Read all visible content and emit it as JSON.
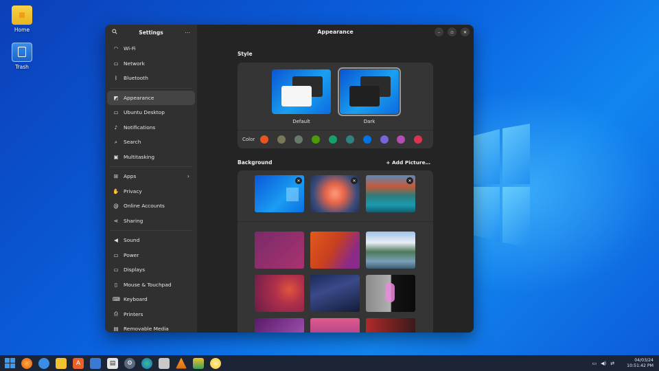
{
  "desktop": {
    "icons": [
      {
        "label": "Home",
        "icon": "folder-icon"
      },
      {
        "label": "Trash",
        "icon": "trash-icon"
      }
    ]
  },
  "sidebar": {
    "title": "Settings",
    "items": [
      {
        "label": "Wi-Fi",
        "icon": "wifi-icon"
      },
      {
        "label": "Network",
        "icon": "network-icon"
      },
      {
        "label": "Bluetooth",
        "icon": "bluetooth-icon"
      },
      {
        "label": "Appearance",
        "icon": "appearance-icon",
        "active": true
      },
      {
        "label": "Ubuntu Desktop",
        "icon": "ubuntu-desktop-icon"
      },
      {
        "label": "Notifications",
        "icon": "bell-icon"
      },
      {
        "label": "Search",
        "icon": "search-icon"
      },
      {
        "label": "Multitasking",
        "icon": "multitasking-icon"
      },
      {
        "label": "Apps",
        "icon": "apps-icon"
      },
      {
        "label": "Privacy",
        "icon": "privacy-icon"
      },
      {
        "label": "Online Accounts",
        "icon": "online-accounts-icon"
      },
      {
        "label": "Sharing",
        "icon": "sharing-icon"
      },
      {
        "label": "Sound",
        "icon": "sound-icon"
      },
      {
        "label": "Power",
        "icon": "power-icon"
      },
      {
        "label": "Displays",
        "icon": "displays-icon"
      },
      {
        "label": "Mouse & Touchpad",
        "icon": "mouse-icon"
      },
      {
        "label": "Keyboard",
        "icon": "keyboard-icon"
      },
      {
        "label": "Printers",
        "icon": "printer-icon"
      },
      {
        "label": "Removable Media",
        "icon": "removable-media-icon"
      }
    ]
  },
  "main": {
    "title": "Appearance",
    "style_label": "Style",
    "styles": [
      {
        "label": "Default",
        "selected": false
      },
      {
        "label": "Dark",
        "selected": true
      }
    ],
    "color_label": "Color",
    "accent_colors": [
      "#e95420",
      "#787859",
      "#657b69",
      "#4e9a06",
      "#18a06a",
      "#308280",
      "#0073e5",
      "#7764d8",
      "#b34cb3",
      "#da3450"
    ],
    "background_label": "Background",
    "add_picture_label": "Add Picture…",
    "custom_wallpapers": [
      "windows-blue",
      "dahlia-flower",
      "mountain-lake"
    ],
    "stock_wallpapers": [
      "purple-bull",
      "orange-map",
      "mountain-fjord",
      "red-circles",
      "milky-way",
      "pink-figure",
      "purple-ornament",
      "sunset-dunes",
      "red-dark"
    ]
  },
  "window_controls": {
    "minimize": "minimize-icon",
    "maximize": "maximize-icon",
    "close": "close-icon"
  },
  "taskbar": {
    "apps": [
      "start-icon",
      "firefox-icon",
      "chat-icon",
      "files-icon",
      "store-icon",
      "python-icon",
      "shop-icon",
      "settings-icon",
      "edge-icon",
      "calculator-icon",
      "vlc-icon",
      "layers-icon",
      "weather-icon"
    ],
    "clock_date": "04/03/24",
    "clock_time": "10:51:42 PM"
  }
}
